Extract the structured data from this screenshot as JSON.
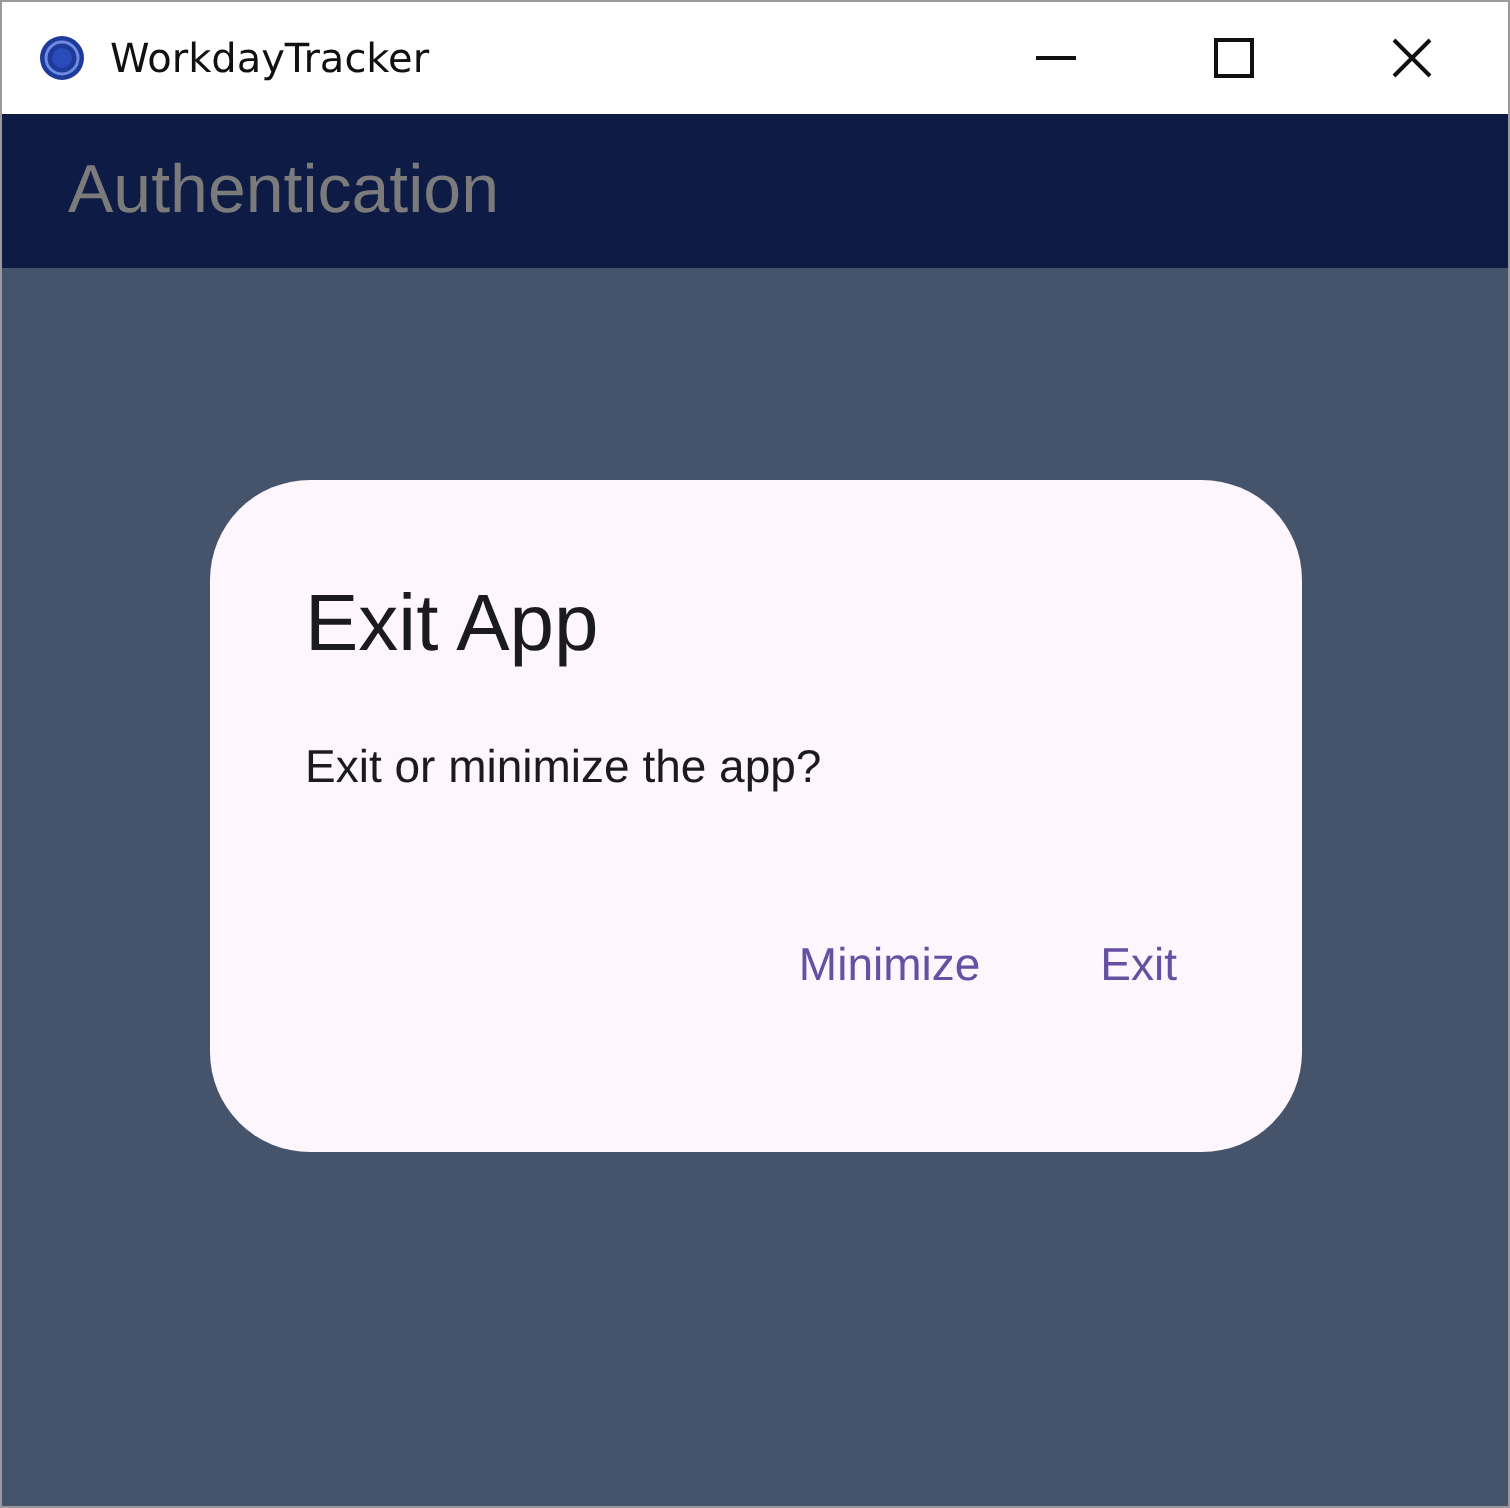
{
  "window": {
    "title": "WorkdayTracker"
  },
  "app_bar": {
    "title": "Authentication"
  },
  "dialog": {
    "title": "Exit App",
    "message": "Exit or minimize the app?",
    "buttons": [
      "Minimize",
      "Exit"
    ]
  }
}
